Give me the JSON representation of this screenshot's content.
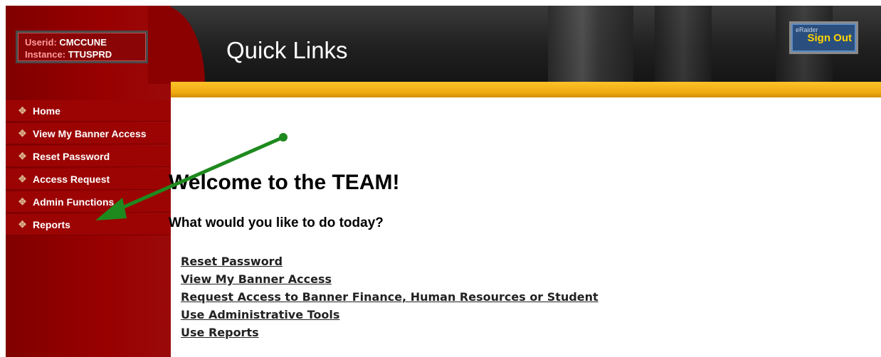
{
  "user": {
    "userid_label": "Userid:",
    "userid": "CMCCUNE",
    "instance_label": "Instance:",
    "instance": "TTUSPRD"
  },
  "header": {
    "title": "Quick Links",
    "signout_small": "eRaider",
    "signout_label": "Sign Out"
  },
  "sidebar": {
    "items": [
      {
        "label": "Home"
      },
      {
        "label": "View My Banner Access"
      },
      {
        "label": "Reset Password"
      },
      {
        "label": "Access Request"
      },
      {
        "label": "Admin Functions"
      },
      {
        "label": "Reports"
      }
    ]
  },
  "main": {
    "welcome": "Welcome to the TEAM!",
    "question": "What would you like to do today?",
    "links": [
      {
        "label": "Reset Password"
      },
      {
        "label": "View My Banner Access"
      },
      {
        "label": "Request Access to Banner Finance, Human Resources or Student"
      },
      {
        "label": "Use Administrative Tools"
      },
      {
        "label": "Use Reports"
      }
    ]
  },
  "colors": {
    "sidebar": "#8b0000",
    "gold_bar": "#f0aa10",
    "annotation_arrow": "#1e8a1e"
  }
}
